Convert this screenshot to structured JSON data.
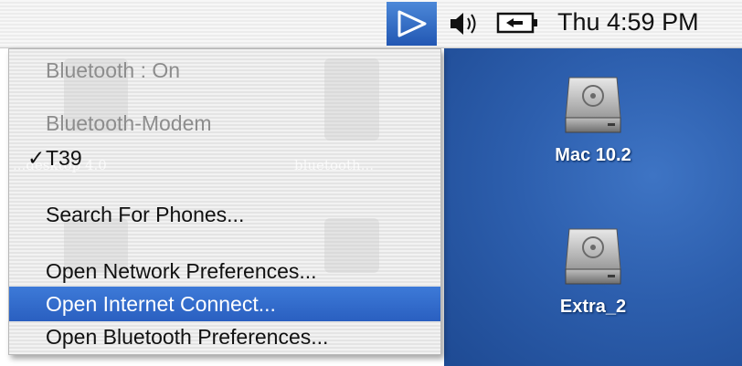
{
  "menubar": {
    "clock": "Thu 4:59 PM",
    "icons": [
      "bluetooth-menu-icon",
      "volume-icon",
      "battery-icon"
    ]
  },
  "bluetooth_menu": {
    "items": [
      {
        "label": "Bluetooth : On",
        "enabled": false
      },
      {
        "label": "Bluetooth-Modem",
        "enabled": false
      },
      {
        "label": "T39",
        "enabled": true,
        "checked": true,
        "check_mark": "✓"
      },
      {
        "label": "Search For Phones...",
        "enabled": true
      },
      {
        "label": "Open Network Preferences...",
        "enabled": true
      },
      {
        "label": "Open Internet Connect...",
        "enabled": true,
        "highlighted": true
      },
      {
        "label": "Open Bluetooth Preferences...",
        "enabled": true
      }
    ]
  },
  "desktop": {
    "icons": [
      {
        "label": "Mac 10.2",
        "icon": "hard-drive-icon"
      },
      {
        "label": "Extra_2",
        "icon": "hard-drive-icon"
      }
    ],
    "background_ghost_labels": [
      "...desktop 4.0",
      "bluetooth..."
    ]
  },
  "colors": {
    "selection": "#2f66c8",
    "desktop": "#2d5fae",
    "menubar_active": "#3b73cc"
  }
}
